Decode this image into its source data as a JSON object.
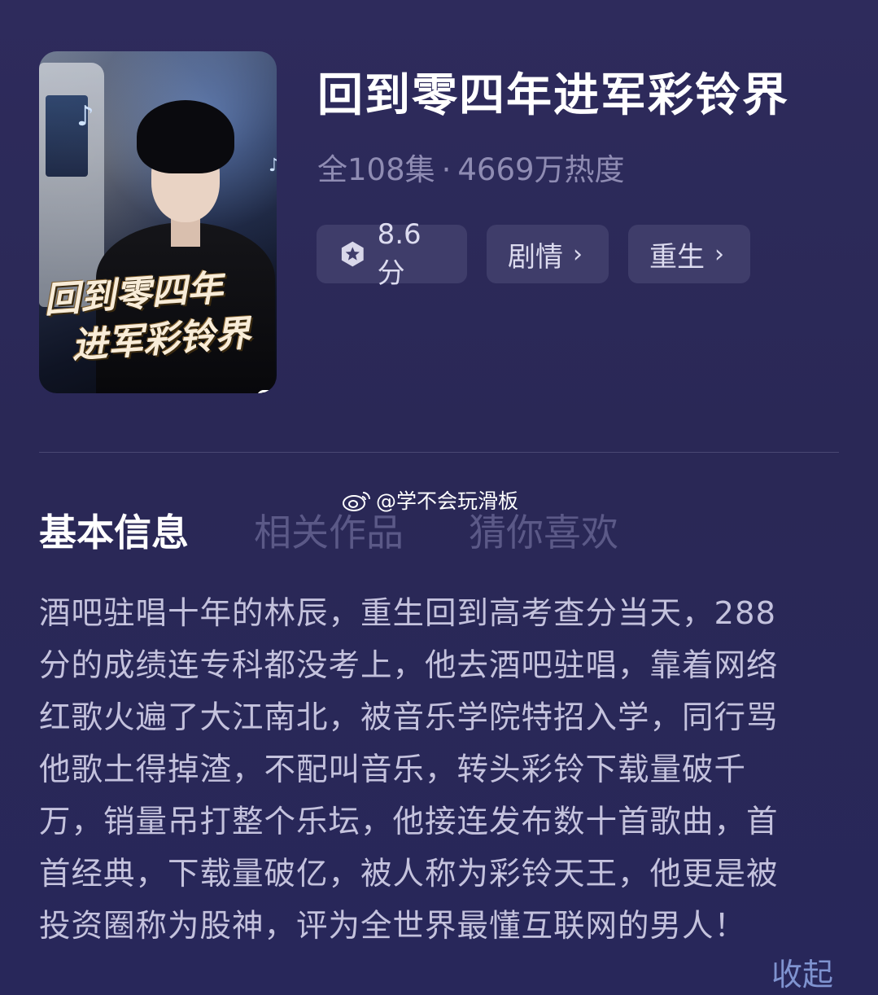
{
  "drama": {
    "title": "回到零四年进军彩铃界",
    "cover_title_line1": "回到零四年",
    "cover_title_line2": "进军彩铃界",
    "episodes": "全108集",
    "separator": "·",
    "popularity": "4669万热度",
    "rating": "8.6分",
    "tags": [
      "剧情",
      "重生"
    ]
  },
  "watermark": {
    "text": "@学不会玩滑板"
  },
  "tabs": [
    {
      "label": "基本信息",
      "active": true
    },
    {
      "label": "相关作品",
      "active": false
    },
    {
      "label": "猜你喜欢",
      "active": false
    }
  ],
  "description": {
    "lines": [
      "酒吧驻唱十年的林辰，重生回到高考查分当天，288",
      "分的成绩连专科都没考上，他去酒吧驻唱，靠着网络",
      "红歌火遍了大江南北，被音乐学院特招入学，同行骂",
      "他歌土得掉渣，不配叫音乐，转头彩铃下载量破千",
      "万，销量吊打整个乐坛，他接连发布数十首歌曲，首",
      "首经典，下载量破亿，被人称为彩铃天王，他更是被",
      "投资圈称为股神，评为全世界最懂互联网的男人！"
    ],
    "collapse_label": "收起"
  },
  "colors": {
    "background": "#2a2856",
    "chip_bg": "#3f3d6a",
    "muted_text": "#8f8cb3",
    "inactive_tab": "#5b5987",
    "link": "#7f93d0"
  },
  "icons": {
    "rating": "star-hexagon-icon",
    "chevron": "chevron-right-icon",
    "weibo": "weibo-icon",
    "play": "play-badge-icon"
  }
}
